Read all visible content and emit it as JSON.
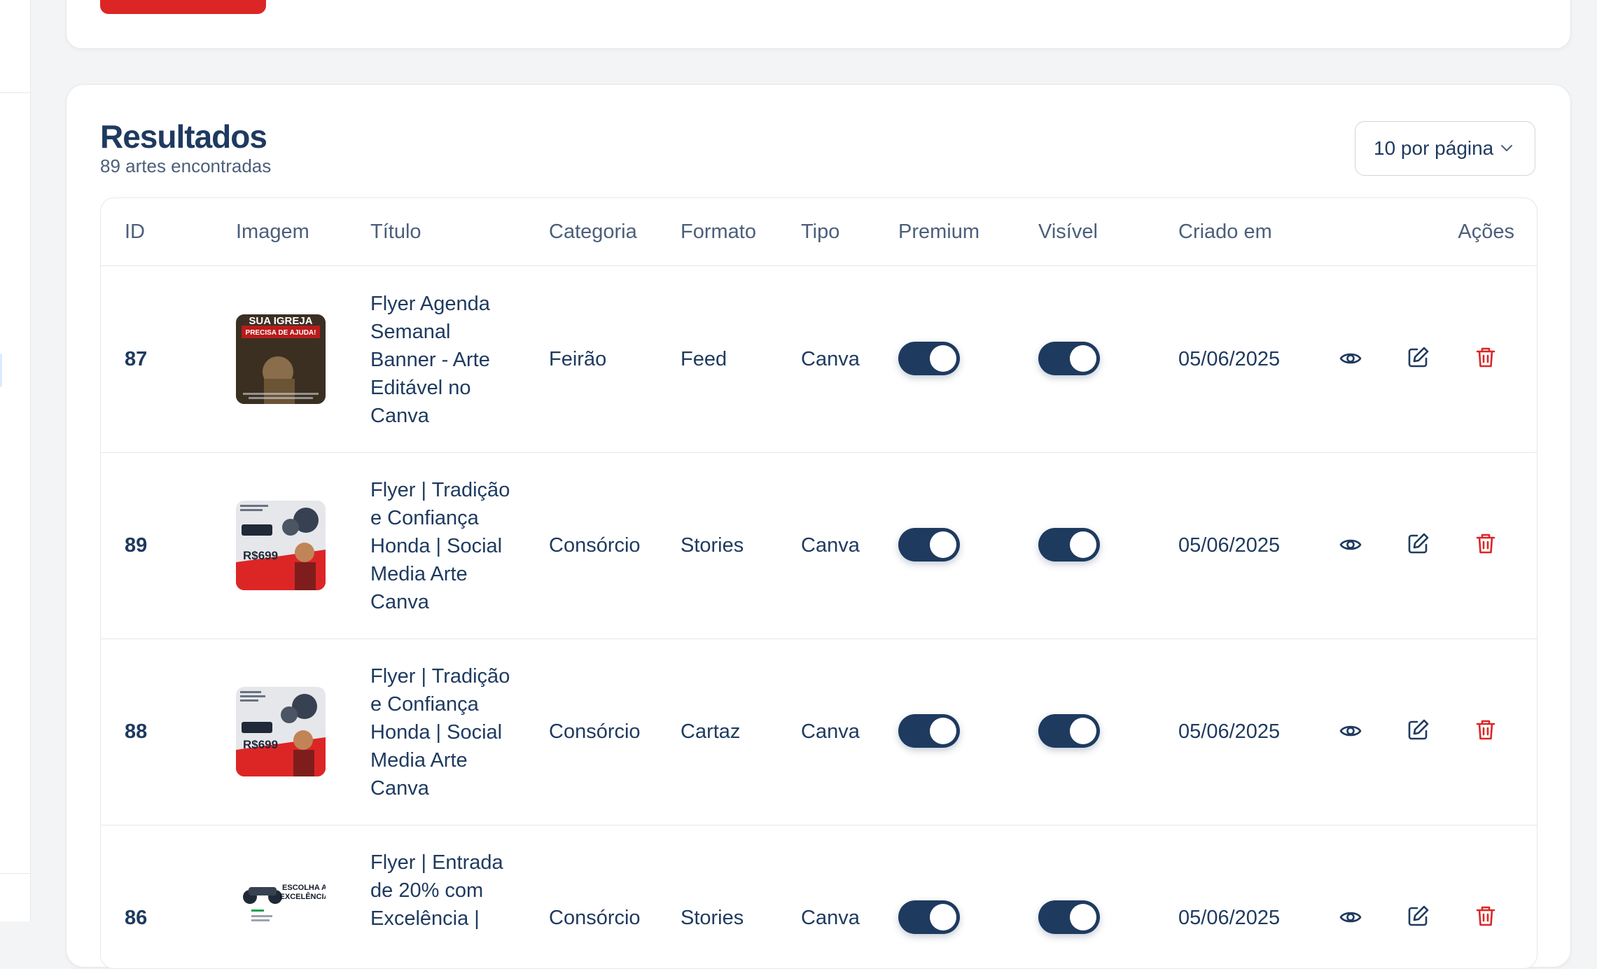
{
  "results": {
    "title": "Resultados",
    "count_text": "89 artes encontradas",
    "per_page": "10 por página"
  },
  "columns": [
    "ID",
    "Imagem",
    "Título",
    "Categoria",
    "Formato",
    "Tipo",
    "Premium",
    "Visível",
    "Criado em",
    "Ações"
  ],
  "rows": [
    {
      "id": "87",
      "title": "Flyer Agenda Semanal Banner - Arte Editável no Canva",
      "categoria": "Feirão",
      "formato": "Feed",
      "tipo": "Canva",
      "premium": true,
      "visivel": true,
      "criado_em": "05/06/2025",
      "thumb_text": {
        "line1": "SUA IGREJA",
        "line2": "PRECISA DE AJUDA!"
      }
    },
    {
      "id": "89",
      "title": "Flyer | Tradição e Confiança Honda | Social Media Arte Canva",
      "categoria": "Consórcio",
      "formato": "Stories",
      "tipo": "Canva",
      "premium": true,
      "visivel": true,
      "criado_em": "05/06/2025",
      "thumb_text": {
        "price": "R$699"
      }
    },
    {
      "id": "88",
      "title": "Flyer | Tradição e Confiança Honda | Social Media Arte Canva",
      "categoria": "Consórcio",
      "formato": "Cartaz",
      "tipo": "Canva",
      "premium": true,
      "visivel": true,
      "criado_em": "05/06/2025",
      "thumb_text": {
        "price": "R$699"
      }
    },
    {
      "id": "86",
      "title": "Flyer | Entrada de 20% com Excelência |",
      "categoria": "Consórcio",
      "formato": "Stories",
      "tipo": "Canva",
      "premium": true,
      "visivel": true,
      "criado_em": "05/06/2025",
      "thumb_text": {
        "line1": "ESCOLHA A",
        "line2": "EXCELÊNCIA"
      }
    }
  ],
  "colors": {
    "primary": "#1e3a5f",
    "danger": "#dc2626",
    "border": "#e5e7eb"
  },
  "icons": {
    "view": "eye-icon",
    "edit": "edit-icon",
    "delete": "trash-icon",
    "dropdown": "chevron-down-icon"
  }
}
